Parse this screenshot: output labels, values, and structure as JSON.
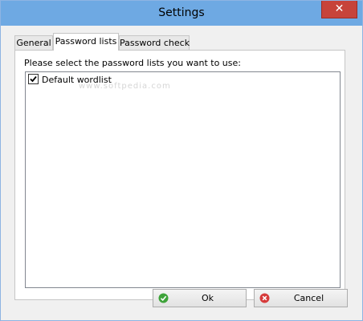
{
  "window": {
    "title": "Settings",
    "close_glyph": "✕"
  },
  "tabs": [
    {
      "label": "General",
      "active": false
    },
    {
      "label": "Password lists",
      "active": true
    },
    {
      "label": "Password check",
      "active": false
    }
  ],
  "password_lists": {
    "prompt": "Please select the password lists you want to use:",
    "items": [
      {
        "label": "Default wordlist",
        "checked": true
      }
    ]
  },
  "watermark": "www.softpedia.com",
  "buttons": {
    "ok_label": "Ok",
    "cancel_label": "Cancel"
  },
  "colors": {
    "titlebar": "#6ea9e3",
    "close": "#c7433a",
    "ok_icon": "#3ea33a",
    "cancel_icon": "#d63b3b"
  }
}
